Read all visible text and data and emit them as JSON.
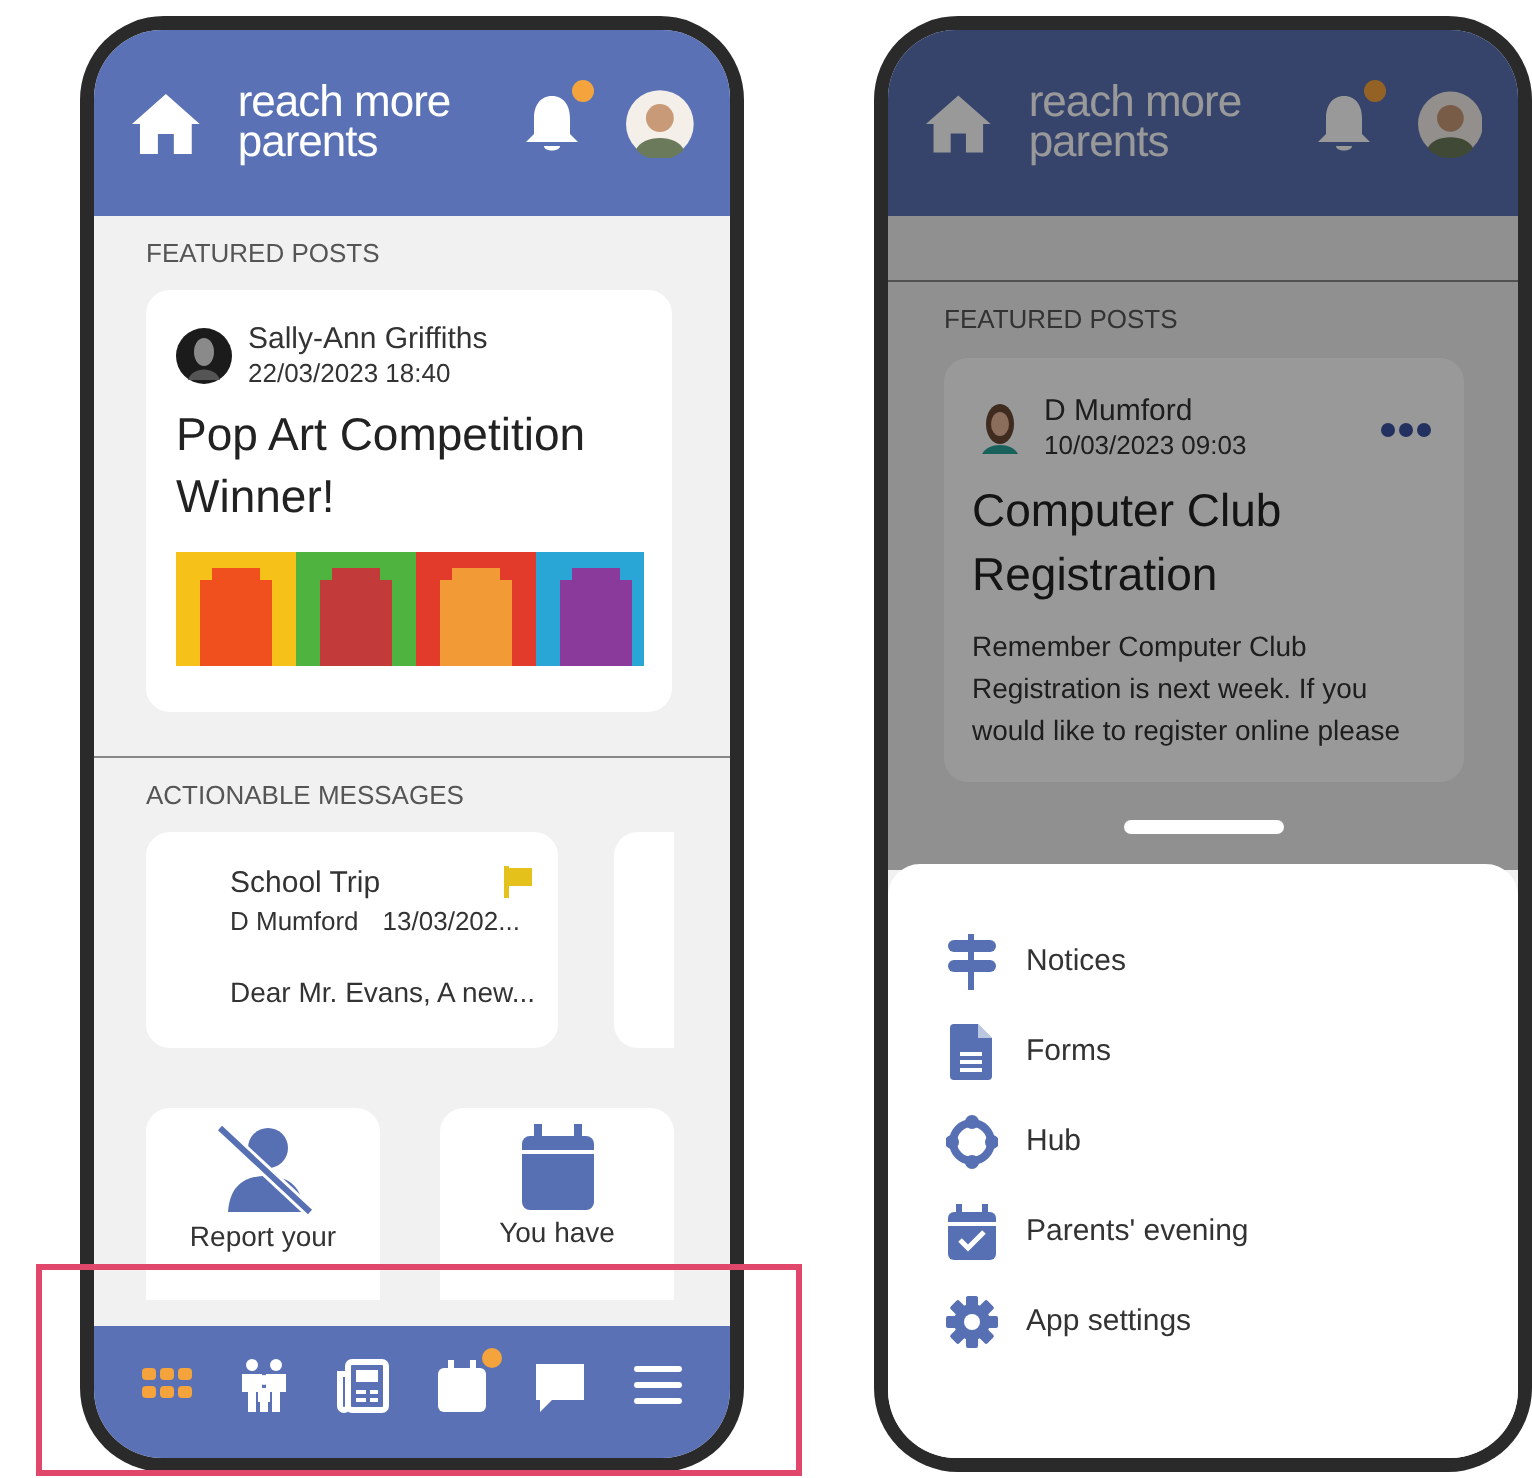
{
  "home_screen": {
    "header": {
      "logo_lines": [
        "reach more",
        "parents"
      ],
      "notification_badge": true
    },
    "featured": {
      "heading": "FEATURED POSTS",
      "post": {
        "author": "Sally-Ann Griffiths",
        "date": "22/03/2023 18:40",
        "title": "Pop Art Competition Winner!"
      }
    },
    "actionable": {
      "heading": "ACTIONABLE MESSAGES",
      "messages": [
        {
          "title": "School Trip",
          "sender": "D Mumford",
          "date": "13/03/202...",
          "preview": "Dear Mr. Evans, A new...",
          "flagged": true
        }
      ]
    },
    "tiles": [
      {
        "kind": "absence",
        "text": "Report your"
      },
      {
        "kind": "calendar",
        "text": "You have"
      }
    ],
    "nav": [
      {
        "kind": "apps",
        "selected": true,
        "badge": false
      },
      {
        "kind": "family",
        "selected": false,
        "badge": false
      },
      {
        "kind": "news",
        "selected": false,
        "badge": false
      },
      {
        "kind": "calendar",
        "selected": false,
        "badge": true
      },
      {
        "kind": "chat",
        "selected": false,
        "badge": false
      },
      {
        "kind": "menu",
        "selected": false,
        "badge": false
      }
    ]
  },
  "menu_screen": {
    "header": {
      "logo_lines": [
        "reach more",
        "parents"
      ],
      "notification_badge": true
    },
    "featured": {
      "heading": "FEATURED POSTS",
      "post": {
        "author": "D Mumford",
        "date": "10/03/2023 09:03",
        "title": "Computer Club Registration",
        "body": "Remember Computer Club Registration is next week. If you would like to register online please"
      }
    },
    "sheet": {
      "items": [
        {
          "kind": "signpost",
          "label": "Notices"
        },
        {
          "kind": "document",
          "label": "Forms"
        },
        {
          "kind": "hub",
          "label": "Hub"
        },
        {
          "kind": "calendar-check",
          "label": "Parents' evening"
        },
        {
          "kind": "gear",
          "label": "App settings"
        }
      ]
    }
  }
}
